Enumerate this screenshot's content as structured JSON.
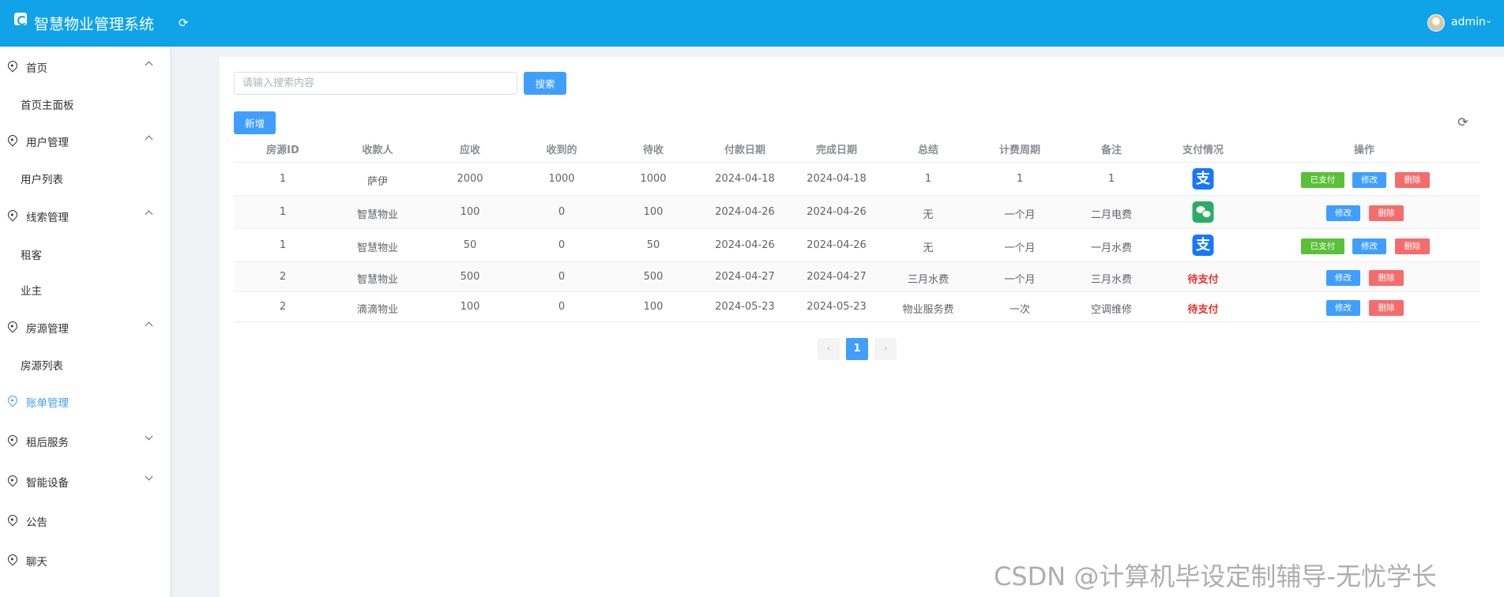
{
  "header": {
    "title": "智慧物业管理系统",
    "username": "admin"
  },
  "sidebar": {
    "items": [
      {
        "label": "首页"
      },
      {
        "label": "首页主面板"
      },
      {
        "label": "用户管理"
      },
      {
        "label": "用户列表"
      },
      {
        "label": "线索管理"
      },
      {
        "label": "租客"
      },
      {
        "label": "业主"
      },
      {
        "label": "房源管理"
      },
      {
        "label": "房源列表"
      },
      {
        "label": "账单管理"
      },
      {
        "label": "租后服务"
      },
      {
        "label": "智能设备"
      },
      {
        "label": "公告"
      },
      {
        "label": "聊天"
      }
    ]
  },
  "search": {
    "placeholder": "请输入搜索内容",
    "button": "搜索"
  },
  "toolbar": {
    "add": "新增"
  },
  "table": {
    "columns": [
      "房源ID",
      "收款人",
      "应收",
      "收到的",
      "待收",
      "付款日期",
      "完成日期",
      "总结",
      "计费周期",
      "备注",
      "支付情况",
      "操作"
    ],
    "rows": [
      {
        "cells": [
          "1",
          "萨伊",
          "2000",
          "1000",
          "1000",
          "2024-04-18",
          "2024-04-18",
          "1",
          "1",
          "1"
        ],
        "payment": "alipay-icon",
        "status_text": ""
      },
      {
        "cells": [
          "1",
          "智慧物业",
          "100",
          "0",
          "100",
          "2024-04-26",
          "2024-04-26",
          "无",
          "一个月",
          "二月电费"
        ],
        "payment": "wechat-icon",
        "status_text": ""
      },
      {
        "cells": [
          "1",
          "智慧物业",
          "50",
          "0",
          "50",
          "2024-04-26",
          "2024-04-26",
          "无",
          "一个月",
          "一月水费"
        ],
        "payment": "alipay-icon",
        "status_text": ""
      },
      {
        "cells": [
          "2",
          "智慧物业",
          "500",
          "0",
          "500",
          "2024-04-27",
          "2024-04-27",
          "三月水费",
          "一个月",
          "三月水费"
        ],
        "payment": "",
        "status_text": "待支付"
      },
      {
        "cells": [
          "2",
          "滴滴物业",
          "100",
          "0",
          "100",
          "2024-05-23",
          "2024-05-23",
          "物业服务费",
          "一次",
          "空调维修"
        ],
        "payment": "",
        "status_text": "待支付"
      }
    ],
    "actions": {
      "paid": "已支付",
      "edit": "修改",
      "delete": "删除"
    }
  },
  "pagination": {
    "prev": "‹",
    "current": "1",
    "next": "›"
  },
  "watermark": "CSDN @计算机毕设定制辅导-无忧学长",
  "colors": {
    "header": "#10a3e8",
    "primary": "#409eff",
    "success": "#5ac03a",
    "danger": "#f56c6c"
  }
}
